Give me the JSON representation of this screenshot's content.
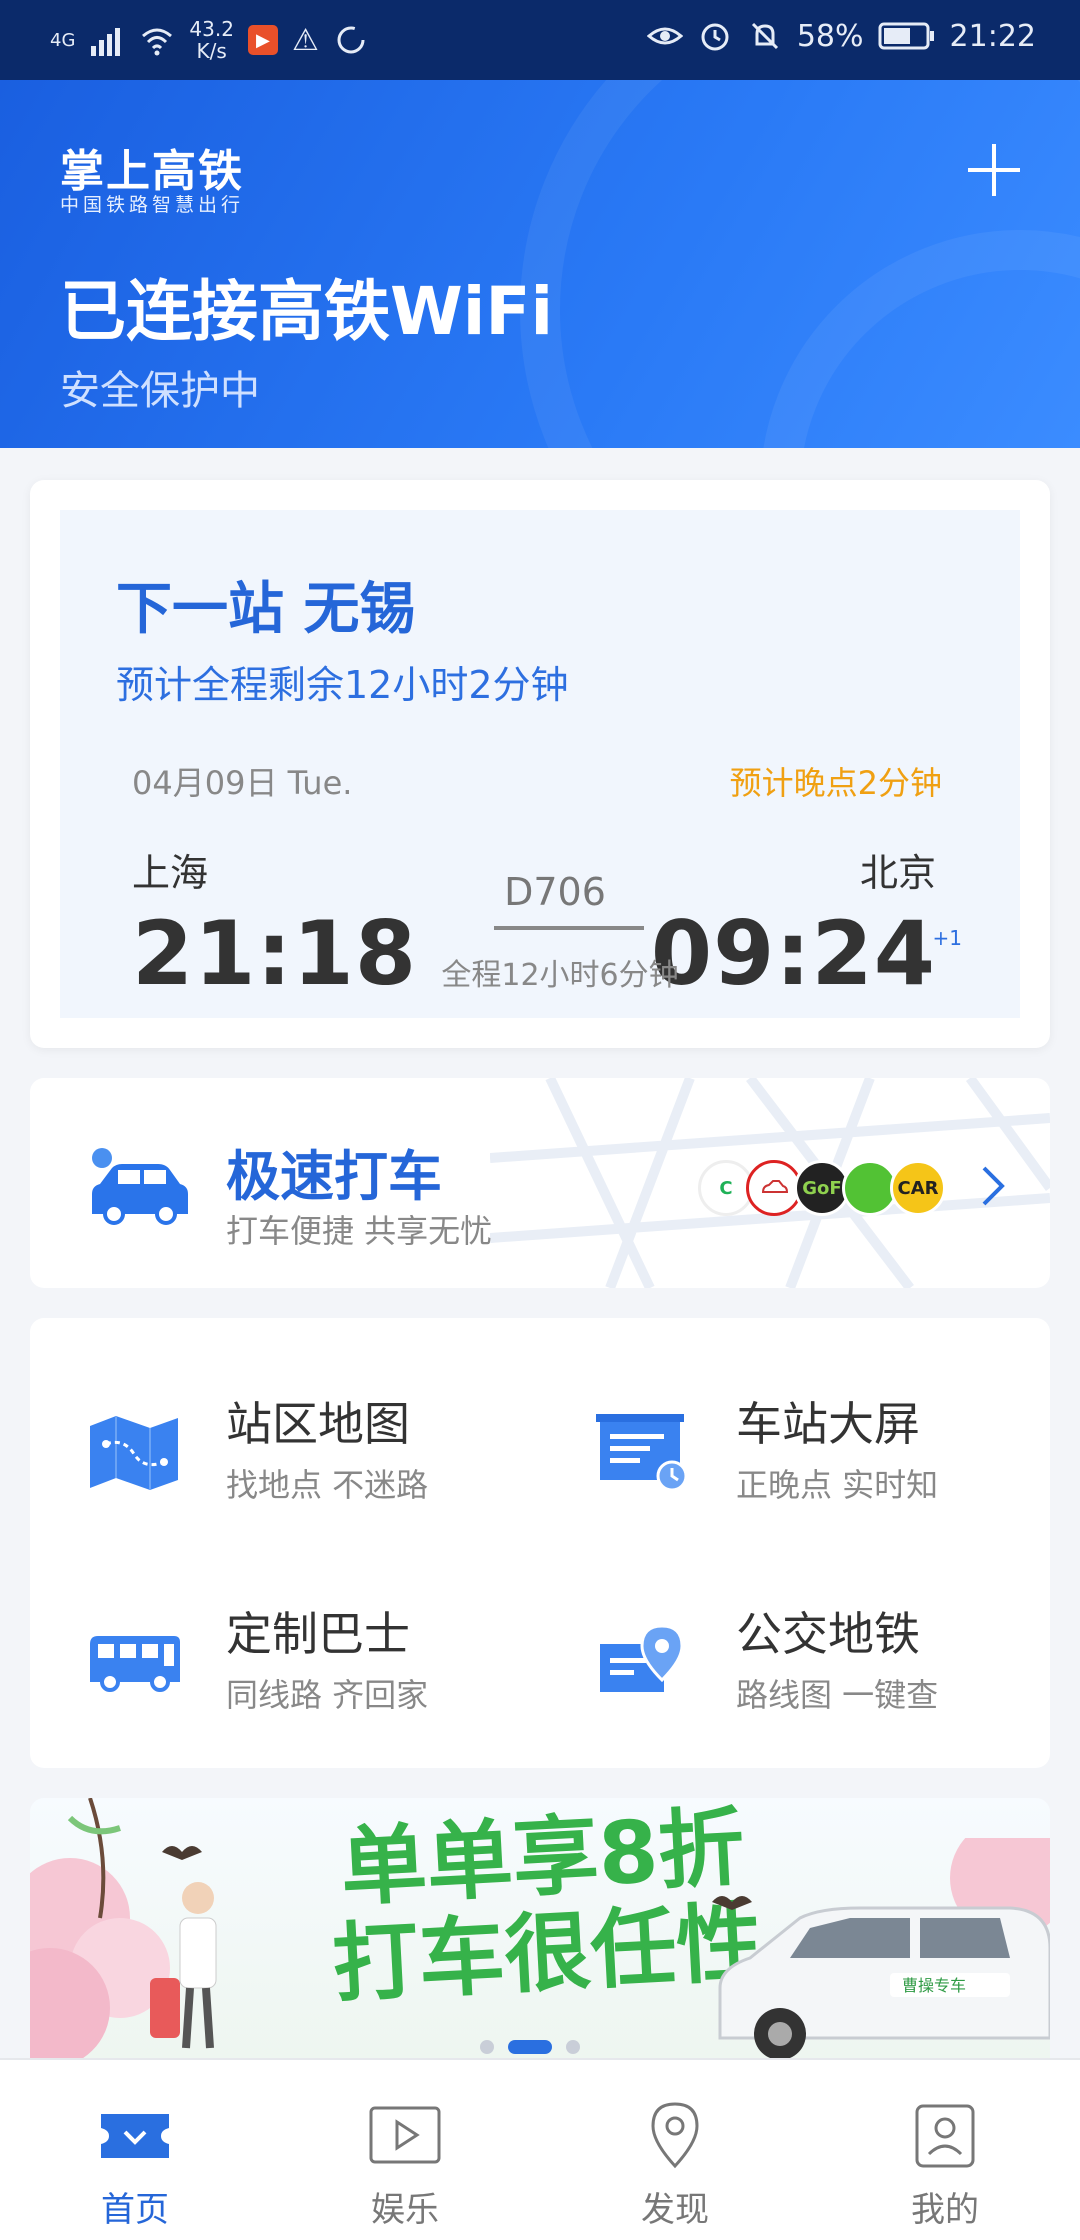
{
  "status_bar": {
    "network": "4G",
    "speed_value": "43.2",
    "speed_unit": "K/s",
    "battery": "58%",
    "time": "21:22"
  },
  "header": {
    "app_name": "掌上高铁",
    "app_tagline": "中国铁路智慧出行",
    "wifi_status": "已连接高铁WiFi",
    "security_status": "安全保护中"
  },
  "trip": {
    "next_station": "下一站 无锡",
    "remaining": "预计全程剩余12小时2分钟",
    "date": "04月09日 Tue.",
    "delay": "预计晚点2分钟",
    "from_city": "上海",
    "to_city": "北京",
    "departure_time": "21:18",
    "arrival_time": "09:24",
    "arrival_day_offset": "+1",
    "train_number": "D706",
    "duration": "全程12小时6分钟"
  },
  "taxi": {
    "title": "极速打车",
    "subtitle": "打车便捷  共享无忧",
    "providers": [
      "C",
      "",
      "GoF",
      "",
      "CAR"
    ]
  },
  "services": [
    {
      "title": "站区地图",
      "subtitle": "找地点  不迷路",
      "icon": "map-icon"
    },
    {
      "title": "车站大屏",
      "subtitle": "正晚点  实时知",
      "icon": "station-screen-icon"
    },
    {
      "title": "定制巴士",
      "subtitle": "同线路  齐回家",
      "icon": "bus-icon"
    },
    {
      "title": "公交地铁",
      "subtitle": "路线图  一键查",
      "icon": "transit-icon"
    }
  ],
  "banner": {
    "line1": "单单享8折",
    "line2": "打车很任性",
    "car_label": "曹操专车",
    "active_index": 1,
    "count": 3
  },
  "nav": {
    "items": [
      {
        "label": "首页",
        "icon": "ticket-icon",
        "active": true
      },
      {
        "label": "娱乐",
        "icon": "play-icon",
        "active": false
      },
      {
        "label": "发现",
        "icon": "location-icon",
        "active": false
      },
      {
        "label": "我的",
        "icon": "profile-icon",
        "active": false
      }
    ]
  },
  "colors": {
    "primary": "#2566d8",
    "status_bar": "#0b2a6a",
    "delay": "#f0a012",
    "banner_green": "#36b24a"
  }
}
